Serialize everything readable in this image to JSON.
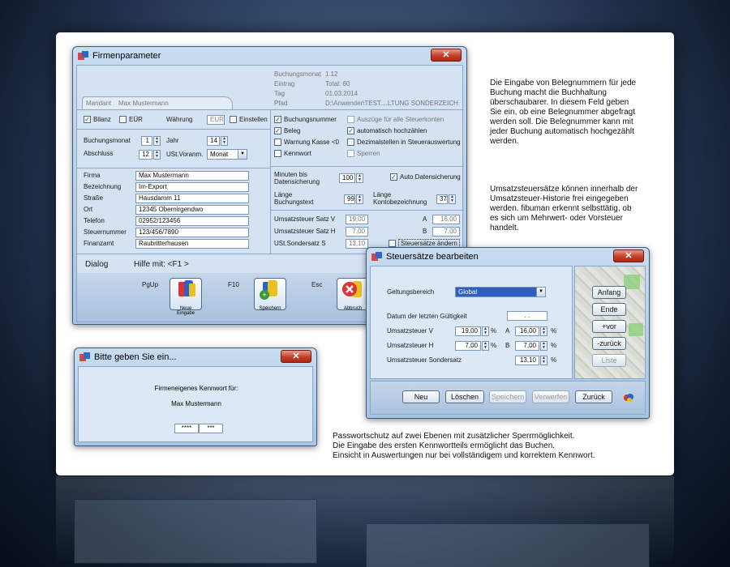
{
  "firmenparameter": {
    "title": "Firmenparameter",
    "info": {
      "buchungsmonat_label": "Buchungsmonat",
      "buchungsmonat_value": "1.12",
      "eintrag_label": "Eintrag",
      "eintrag_value": "Total: 60",
      "tag_label": "Tag",
      "tag_value": "01.03.2014",
      "pfad_label": "Pfad",
      "pfad_value": "D:\\Anwender\\TEST....LTUNG SONDERZEICH"
    },
    "tab_label": "Mandant",
    "tab_value": "Max Mustermann",
    "bilanz_label": "Bilanz",
    "eur_label": "EÜR",
    "waehrung_label": "Währung",
    "waehrung_value": "EUR",
    "einstellen_label": "Einstellen",
    "buchungsmonat_label": "Buchungsmonat",
    "buchungsmonat_value": "1",
    "jahr_label": "Jahr",
    "jahr_value": "14",
    "abschluss_label": "Abschluss",
    "abschluss_value": "12",
    "ustvoranm_label": "USt.Voranm.",
    "ustvoranm_value": "Monat",
    "options": {
      "buchungsnummer": "Buchungsnummer",
      "auszuege": "Auszüge für alle Steuerkonten",
      "beleg": "Beleg",
      "auto_hochzaehlen": "automatisch hochzählen",
      "warnung": "Warnung Kasse <0",
      "dezimalstellen": "Dezimalstellen in Steuerauswertung",
      "kennwort": "Kennwort",
      "sperren": "Sperren"
    },
    "address": {
      "firma_label": "Firma",
      "firma": "Max Mustermann",
      "bezeichnung_label": "Bezeichnung",
      "bezeichnung": "Im-Export",
      "strasse_label": "Straße",
      "strasse": "Hausdamm 11",
      "ort_label": "Ort",
      "ort": "12345 Obernirgendwo",
      "telefon_label": "Telefon",
      "telefon": "02952/123456",
      "steuernummer_label": "Steuernummer",
      "steuernummer": "123/456/7890",
      "finanzamt_label": "Finanzamt",
      "finanzamt": "Raubritterhausen"
    },
    "minuten_label1": "Minuten bis",
    "minuten_label2": "Datensicherung",
    "minuten_value": "100",
    "auto_datensicherung": "Auto Datensicherung",
    "laenge_buchungstext_1": "Länge",
    "laenge_buchungstext_2": "Buchungstext",
    "laenge_buchungstext_value": "99",
    "laenge_konto_1": "Länge",
    "laenge_konto_2": "Kontobezeichnung",
    "laenge_konto_value": "37",
    "ust_v_label": "Umsatzsteuer Satz V",
    "ust_v_value": "19,00",
    "ust_h_label": "Umsatzsteuer Satz H",
    "ust_h_value": "7,00",
    "ust_s_label": "USt.Sondersatz S",
    "ust_s_value": "13,10",
    "a_label": "A",
    "a_value": "16,00",
    "b_label": "B",
    "b_value": "7,00",
    "steuersaetze_aendern": "Steuersätze ändern",
    "dialog_label": "Dialog",
    "hilfe": "Hilfe mit: <F1 >",
    "key_pgup": "PgUp",
    "key_f10": "F10",
    "key_esc": "Esc",
    "neue_eingabe": "Neue Eingabe",
    "speichern": "Speichern",
    "abbruch": "Abbruch"
  },
  "kennwort_dialog": {
    "title": "Bitte geben Sie ein...",
    "prompt": "Firmeneigenes Kennwort für:",
    "name": "Max Mustermann",
    "pw1": "****",
    "pw2": "***"
  },
  "steuersaetze": {
    "title": "Steuersätze bearbeiten",
    "geltungsbereich_label": "Geltungsbereich",
    "geltungsbereich_value": "Global",
    "datum_label": "Datum der letzten Gültigkeit",
    "datum_value": ". .",
    "ust_v_label": "Umsatzsteuer V",
    "ust_v_value": "19,00",
    "ust_h_label": "Umsatzsteuer H",
    "ust_h_value": "7,00",
    "ust_sonder_label": "Umsatzsteuer Sondersatz",
    "ust_sonder_value": "13,10",
    "a_label": "A",
    "a_value": "16,00",
    "b_label": "B",
    "b_value": "7,00",
    "pct": "%",
    "nav": {
      "anfang": "Anfang",
      "ende": "Ende",
      "vor": "+vor",
      "zurueck": "-zurück",
      "liste": "Liste"
    },
    "buttons": {
      "neu": "Neu",
      "loeschen": "Löschen",
      "speichern": "Speichern",
      "verwerfen": "Verwerfen",
      "zurueck": "Zurück"
    }
  },
  "descriptions": {
    "belegnummern": [
      "Die Eingabe von Belegnummern für jede",
      "Buchung macht die Buchhaltung",
      "überschaubarer. In diesem Feld geben",
      "Sie ein, ob eine Belegnummer abgefragt",
      "werden soll. Die Belegnummer kann mit",
      "jeder Buchung automatisch hochgezählt",
      "werden."
    ],
    "umsatzsteuer": [
      "Umsatzsteuersätze können innerhalb der",
      "Umsatzsteuer-Historie frei eingegeben",
      "werden. fibuman erkennt selbsttätig, ob",
      "es sich um Mehrwert- oder Vorsteuer",
      "handelt."
    ],
    "passwort": [
      "Passwortschutz auf zwei Ebenen mit zusätzlicher Sperrmöglichkeit.",
      "Die Eingabe des ersten Kennwortteils ermöglicht das Buchen.",
      "Einsicht in Auswertungen nur bei vollständigem und korrektem Kennwort."
    ]
  }
}
